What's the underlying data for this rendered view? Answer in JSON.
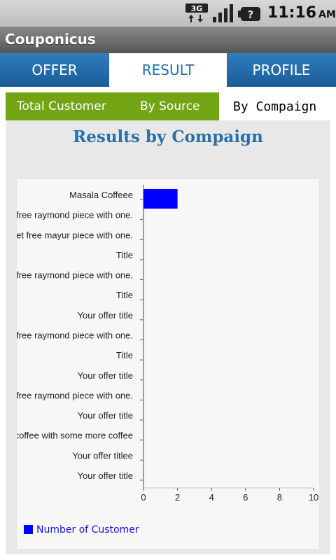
{
  "status_bar": {
    "network": "3G",
    "time": "11:16",
    "ampm": "AM",
    "icons": [
      "3g-icon",
      "signal-icon",
      "battery-unknown-icon"
    ]
  },
  "app": {
    "title": "Couponicus"
  },
  "main_tabs": [
    {
      "label": "OFFER",
      "selected": false
    },
    {
      "label": "RESULT",
      "selected": true
    },
    {
      "label": "PROFILE",
      "selected": false
    }
  ],
  "sub_tabs": [
    {
      "label": "Total Customer",
      "selected": false
    },
    {
      "label": "By Source",
      "selected": false
    },
    {
      "label": "By Compaign",
      "selected": true
    }
  ],
  "colors": {
    "accent_blue": "#1f6fb5",
    "sub_tab_green": "#72a414",
    "bar": "#0000ff",
    "title_blue": "#2a6fa8"
  },
  "chart_data": {
    "type": "bar",
    "orientation": "horizontal",
    "title": "Results by Compaign",
    "categories": [
      "Masala Coffeee",
      "get free raymond piece with one.",
      "get free mayur piece with one.",
      "Title",
      "get free raymond piece with one.",
      "Title",
      "Your offer title",
      "get free raymond piece with one.",
      "Title",
      "Your offer title",
      "get free raymond piece with one.",
      "Your offer title",
      "coffee with some more coffee",
      "Your offer titlee",
      "Your offer title"
    ],
    "series": [
      {
        "name": "Number of Customer",
        "values": [
          2,
          0,
          0,
          0,
          0,
          0,
          0,
          0,
          0,
          0,
          0,
          0,
          0,
          0,
          0
        ]
      }
    ],
    "xlim": [
      0,
      10
    ],
    "xticks": [
      "0",
      "2",
      "4",
      "6",
      "8",
      "10"
    ],
    "grid": false,
    "legend_position": "bottom-left"
  }
}
